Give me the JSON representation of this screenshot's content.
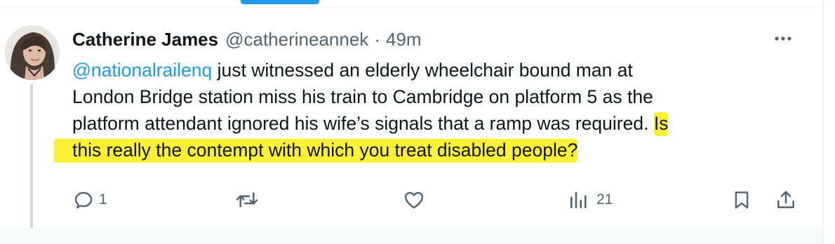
{
  "tweet": {
    "author": {
      "display_name": "Catherine James",
      "handle": "@catherineannek",
      "separator": "·",
      "time": "49m"
    },
    "text": {
      "mention": "@nationalrailenq",
      "line1_rest": " just witnessed an elderly wheelchair bound man at",
      "line2": "London Bridge station miss his train to Cambridge on platform 5 as the",
      "line3_plain": "platform attendant ignored his wife’s signals that a ramp was required.",
      "line3_highlight": "Is",
      "line4_highlight": "this really the contempt with which you treat disabled people?"
    },
    "highlight_color": "#fbf033",
    "accent_color": "#1d9bf0",
    "actions": {
      "reply_count": "1",
      "views_count": "21"
    }
  }
}
